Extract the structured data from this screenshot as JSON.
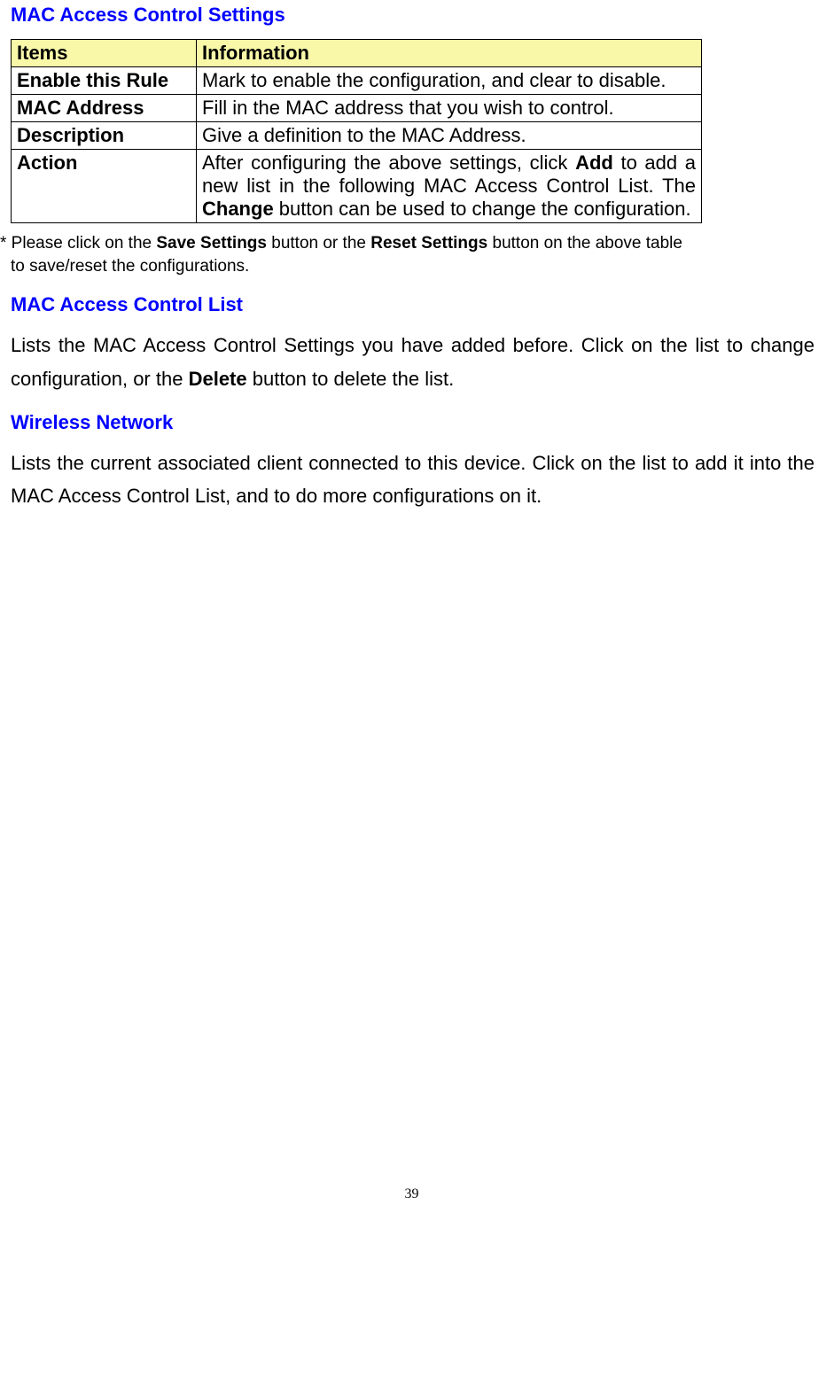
{
  "headings": {
    "main": "MAC Access Control Settings",
    "list": "MAC Access Control List",
    "wireless": "Wireless Network"
  },
  "table": {
    "header": {
      "col1": "Items",
      "col2": "Information"
    },
    "rows": {
      "enable": {
        "label": "Enable this Rule",
        "info": "Mark to enable the configuration, and clear to disable."
      },
      "mac": {
        "label": "MAC Address",
        "info": "Fill in the MAC address that you wish to control."
      },
      "desc": {
        "label": "Description",
        "info": "Give a definition to the MAC Address."
      },
      "action": {
        "label": "Action",
        "info_part1": "After configuring the above settings, click ",
        "info_bold1": "Add",
        "info_part2": " to add a new list in the following MAC Access Control List. The ",
        "info_bold2": "Change",
        "info_part3": " button can be used to change the configuration."
      }
    }
  },
  "footnote": {
    "part1": "* Please click on the ",
    "bold1": "Save Settings",
    "part2": " button or the ",
    "bold2": "Reset Settings",
    "part3": " button on the above table",
    "line2": "to save/reset the configurations."
  },
  "sections": {
    "list_text_part1": "Lists the MAC Access Control Settings you have added before. Click on the list to change configuration, or the ",
    "list_text_bold": "Delete",
    "list_text_part2": " button to delete the list.",
    "wireless_text": "Lists the current associated client connected to this device. Click on the list to add it into the MAC Access Control List, and to do more configurations on it."
  },
  "page_number": "39"
}
